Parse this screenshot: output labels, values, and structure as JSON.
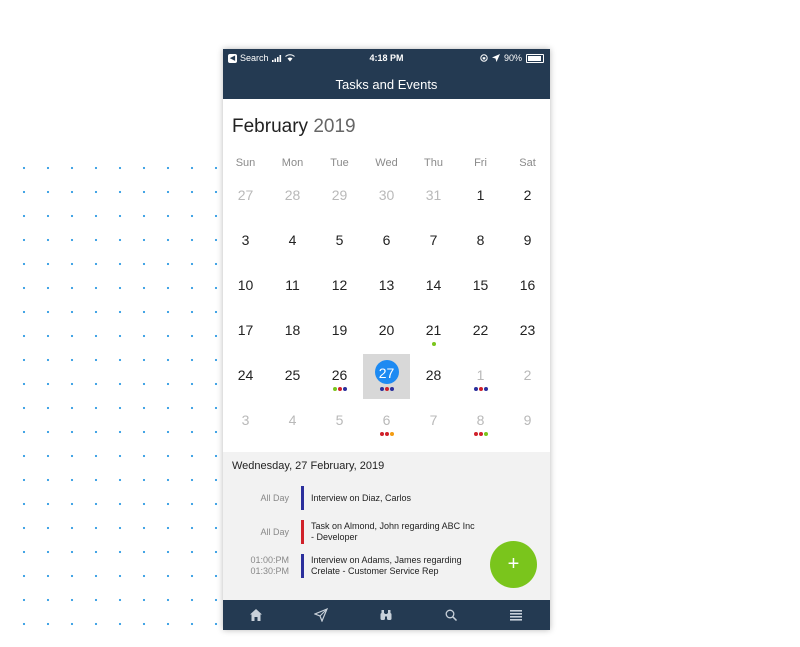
{
  "status_bar": {
    "back_app_label": "Search",
    "time": "4:18 PM",
    "battery_text": "90%",
    "battery_level": 0.9
  },
  "nav": {
    "title": "Tasks and Events"
  },
  "calendar": {
    "month": "February",
    "year": "2019",
    "weekdays": [
      "Sun",
      "Mon",
      "Tue",
      "Wed",
      "Thu",
      "Fri",
      "Sat"
    ],
    "weeks": [
      [
        {
          "d": "27",
          "m": true
        },
        {
          "d": "28",
          "m": true
        },
        {
          "d": "29",
          "m": true
        },
        {
          "d": "30",
          "m": true
        },
        {
          "d": "31",
          "m": true
        },
        {
          "d": "1"
        },
        {
          "d": "2"
        }
      ],
      [
        {
          "d": "3"
        },
        {
          "d": "4"
        },
        {
          "d": "5"
        },
        {
          "d": "6"
        },
        {
          "d": "7"
        },
        {
          "d": "8"
        },
        {
          "d": "9"
        }
      ],
      [
        {
          "d": "10"
        },
        {
          "d": "11"
        },
        {
          "d": "12"
        },
        {
          "d": "13"
        },
        {
          "d": "14"
        },
        {
          "d": "15"
        },
        {
          "d": "16"
        }
      ],
      [
        {
          "d": "17"
        },
        {
          "d": "18"
        },
        {
          "d": "19"
        },
        {
          "d": "20"
        },
        {
          "d": "21",
          "dots": [
            "#7ac51c"
          ]
        },
        {
          "d": "22"
        },
        {
          "d": "23"
        }
      ],
      [
        {
          "d": "24"
        },
        {
          "d": "25"
        },
        {
          "d": "26",
          "dots": [
            "#7ac51c",
            "#d0212a",
            "#2b2f9c"
          ]
        },
        {
          "d": "27",
          "selected": true,
          "dots": [
            "#2b2f9c",
            "#d0212a",
            "#2b2f9c"
          ]
        },
        {
          "d": "28"
        },
        {
          "d": "1",
          "m": true,
          "dots": [
            "#2b2f9c",
            "#d0212a",
            "#2b2f9c"
          ]
        },
        {
          "d": "2",
          "m": true
        }
      ],
      [
        {
          "d": "3",
          "m": true
        },
        {
          "d": "4",
          "m": true
        },
        {
          "d": "5",
          "m": true
        },
        {
          "d": "6",
          "m": true,
          "dots": [
            "#d0212a",
            "#d0212a",
            "#f39c12"
          ]
        },
        {
          "d": "7",
          "m": true
        },
        {
          "d": "8",
          "m": true,
          "dots": [
            "#d0212a",
            "#d0212a",
            "#7ac51c"
          ]
        },
        {
          "d": "9",
          "m": true
        }
      ]
    ]
  },
  "agenda": {
    "date_heading": "Wednesday, 27 February, 2019",
    "items": [
      {
        "time": "All Day",
        "time2": "",
        "text": "Interview on Diaz, Carlos",
        "text2": "",
        "color": "#2b2f9c"
      },
      {
        "time": "All Day",
        "time2": "",
        "text": "Task on Almond, John regarding ABC Inc",
        "text2": "- Developer",
        "color": "#d0212a"
      },
      {
        "time": "01:00:PM",
        "time2": "01:30:PM",
        "text": "Interview on Adams, James regarding",
        "text2": "Crelate - Customer Service Rep",
        "color": "#2b2f9c"
      }
    ]
  },
  "fab": {
    "label": "+"
  },
  "tabs": [
    {
      "name": "home-icon"
    },
    {
      "name": "send-icon"
    },
    {
      "name": "binoculars-icon"
    },
    {
      "name": "search-icon"
    },
    {
      "name": "menu-icon"
    }
  ],
  "colors": {
    "brand": "#243a52",
    "accent_blue": "#1d8af2",
    "fab_green": "#7ac51c"
  }
}
